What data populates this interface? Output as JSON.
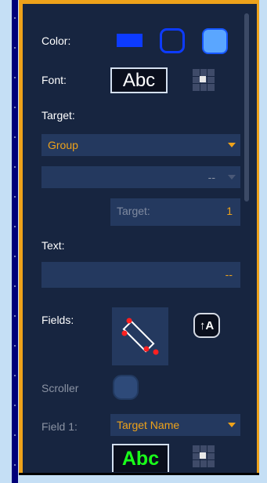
{
  "labels": {
    "color": "Color:",
    "font": "Font:",
    "target": "Target:",
    "text": "Text:",
    "fields": "Fields:",
    "scroller": "Scroller",
    "field1": "Field 1:"
  },
  "color_swatches": {
    "fill": "#0d3bff",
    "outline": "#0d3bff",
    "filled_rounded": "#5aa6ff"
  },
  "font_preview": "Abc",
  "target": {
    "type_value": "Group",
    "second_value": "--",
    "number_label": "Target:",
    "number_value": "1"
  },
  "text_field": {
    "value": "--"
  },
  "fields": {
    "auto_label": "↑A",
    "field1_value": "Target Name",
    "field1_font_preview": "Abc",
    "field1_font_color": "#1aff1a"
  },
  "accent": "#eea21a",
  "panel_bg": "#172540"
}
